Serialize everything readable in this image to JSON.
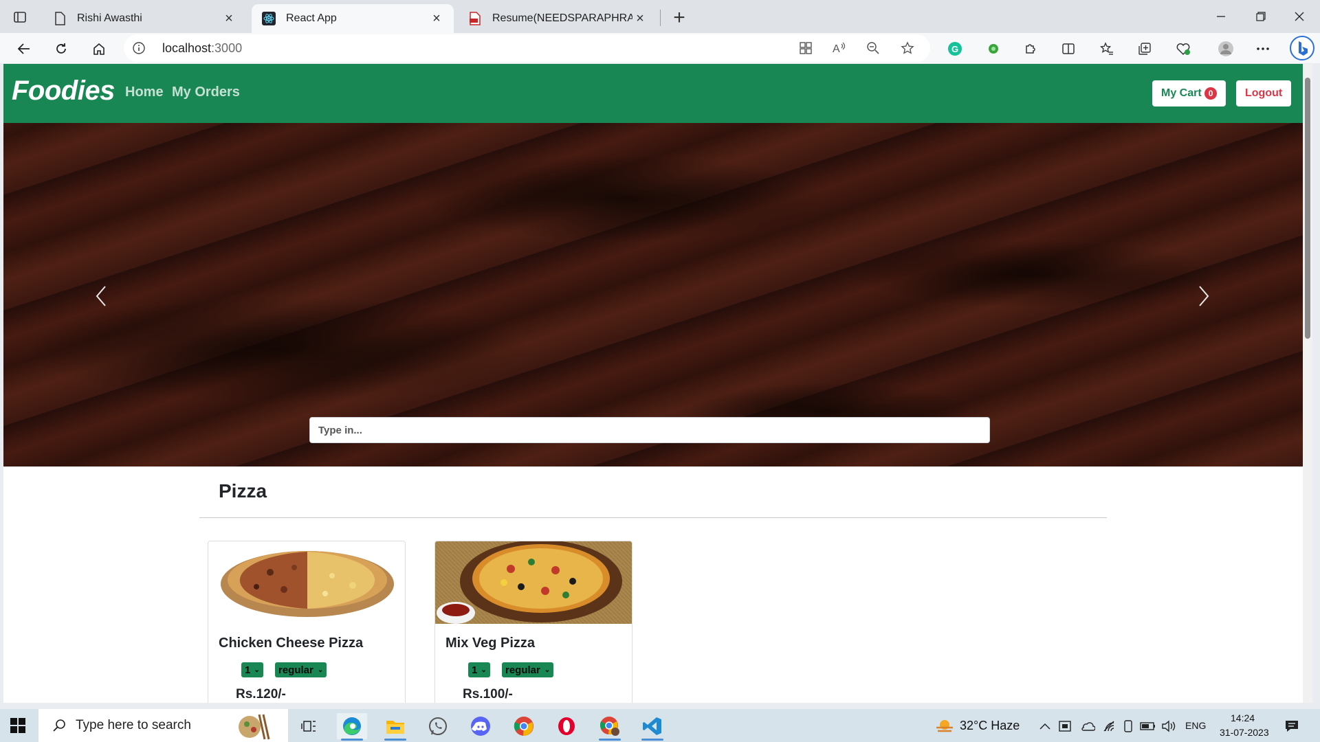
{
  "browser": {
    "tabs": [
      {
        "title": "Rishi Awasthi",
        "active": false
      },
      {
        "title": "React App",
        "active": true
      },
      {
        "title": "Resume(NEEDSPARAPHRASING)",
        "active": false
      }
    ],
    "url_host": "localhost",
    "url_port": ":3000"
  },
  "app": {
    "brand": "Foodies",
    "nav": {
      "home": "Home",
      "orders": "My Orders"
    },
    "cart_label": "My Cart",
    "cart_count": "0",
    "logout_label": "Logout",
    "search_placeholder": "Type in...",
    "category": "Pizza",
    "items": [
      {
        "name": "Chicken Cheese Pizza",
        "qty": "1",
        "size": "regular",
        "price": "Rs.120/-"
      },
      {
        "name": "Mix Veg Pizza",
        "qty": "1",
        "size": "regular",
        "price": "Rs.100/-"
      }
    ]
  },
  "taskbar": {
    "search_placeholder": "Type here to search",
    "weather": "32°C  Haze",
    "lang": "ENG",
    "time": "14:24",
    "date": "31-07-2023"
  },
  "colors": {
    "brand_green": "#198754",
    "badge_red": "#dc3545"
  }
}
